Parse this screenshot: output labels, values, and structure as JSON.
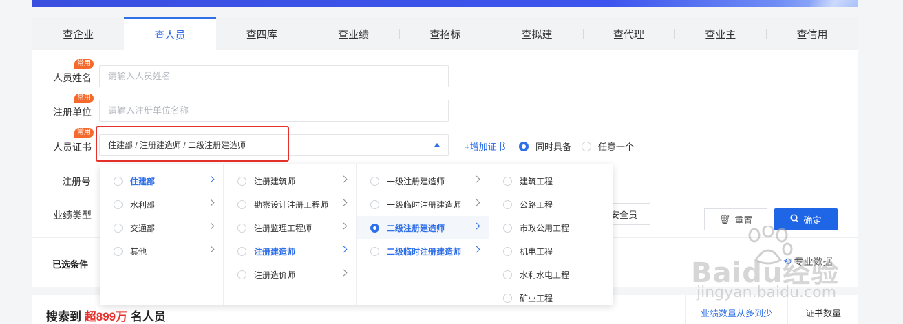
{
  "tabs": [
    "查企业",
    "查人员",
    "查四库",
    "查业绩",
    "查招标",
    "查拟建",
    "查代理",
    "查业主",
    "查信用"
  ],
  "active_tab": "查人员",
  "badge_text": "常用",
  "form": {
    "name_label": "人员姓名",
    "name_placeholder": "请输入人员姓名",
    "unit_label": "注册单位",
    "unit_placeholder": "请输入注册单位名称",
    "cert_label": "人员证书",
    "cert_value": "住建部 / 注册建造师 / 二级注册建造师",
    "regno_label": "注册号",
    "perf_label": "业绩类型",
    "add_cert": "+增加证书",
    "option_all": "同时具备",
    "option_any": "任意一个"
  },
  "buttons": {
    "safety_fragment": "安全员",
    "reset": "重置",
    "confirm": "确定"
  },
  "selected_conditions_label": "已选条件",
  "professional_data": "专业数据",
  "cascader": {
    "col1": [
      "住建部",
      "水利部",
      "交通部",
      "其他"
    ],
    "col2": [
      "注册建筑师",
      "勘察设计注册工程师",
      "注册监理工程师",
      "注册建造师",
      "注册造价师"
    ],
    "col3": [
      "一级注册建造师",
      "一级临时注册建造师",
      "二级注册建造师",
      "二级临时注册建造师"
    ],
    "col4": [
      "建筑工程",
      "公路工程",
      "市政公用工程",
      "机电工程",
      "水利水电工程",
      "矿业工程"
    ]
  },
  "results": {
    "prefix": "搜索到",
    "count": "超899万",
    "suffix": "名人员",
    "sort_performance": "业绩数量从多到少",
    "sort_cert": "证书数量"
  },
  "watermark": {
    "brand": "Baidu经验",
    "url": "jingyan.baidu.com"
  },
  "colors": {
    "accent": "#2f6fe8",
    "badge": "#f56a2c",
    "highlight_red": "#e6312c",
    "confirm_button": "#1f66e6"
  }
}
